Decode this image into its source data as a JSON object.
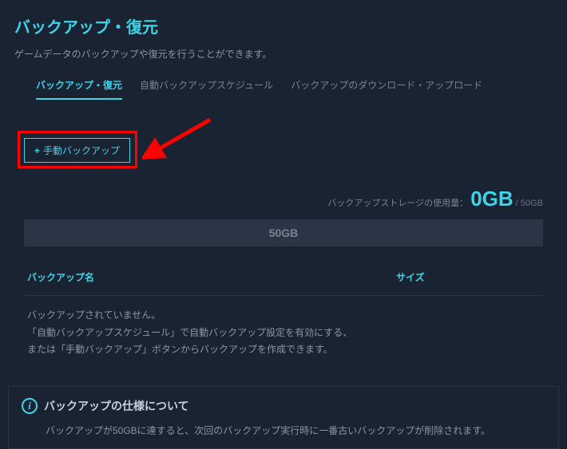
{
  "page": {
    "title": "バックアップ・復元",
    "subtitle": "ゲームデータのバックアップや復元を行うことができます。"
  },
  "tabs": {
    "backup_restore": "バックアップ・復元",
    "auto_schedule": "自動バックアップスケジュール",
    "download_upload": "バックアップのダウンロード・アップロード"
  },
  "button": {
    "manual_backup": "手動バックアップ"
  },
  "storage": {
    "label": "バックアップストレージの使用量：",
    "used": "0GB",
    "total": " / 50GB",
    "bar_label": "50GB"
  },
  "table": {
    "col_name": "バックアップ名",
    "col_size": "サイズ"
  },
  "empty": {
    "line1": "バックアップされていません。",
    "line2": "「自動バックアップスケジュール」で自動バックアップ設定を有効にする、",
    "line3": "または「手動バックアップ」ボタンからバックアップを作成できます。"
  },
  "info": {
    "title": "バックアップの仕様について",
    "body": "バックアップが50GBに達すると、次回のバックアップ実行時に一番古いバックアップが削除されます。"
  }
}
